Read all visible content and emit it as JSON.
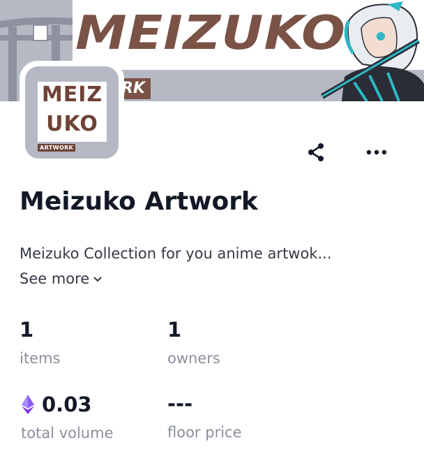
{
  "banner": {
    "brand_word": "MEIZUKO",
    "sub_word": "RK",
    "colors": {
      "brown": "#7a5246",
      "gray": "#b5b9c3"
    }
  },
  "avatar": {
    "line1": "MEIZ",
    "line2": "UKO",
    "tag": "ARTWORK"
  },
  "actions": {
    "share_icon": "share-icon",
    "more_icon": "more-horizontal-icon"
  },
  "collection": {
    "title": "Meizuko Artwork",
    "description": "Meizuko Collection for you anime artwok...",
    "see_more": "See more"
  },
  "stats": {
    "items": {
      "value": "1",
      "label": "items"
    },
    "owners": {
      "value": "1",
      "label": "owners"
    },
    "total_volume": {
      "value": "0.03",
      "label": "total volume",
      "currency_icon": "ethereum-icon",
      "currency_color": "#8b5cf6"
    },
    "floor_price": {
      "value": "---",
      "label": "floor price"
    }
  }
}
